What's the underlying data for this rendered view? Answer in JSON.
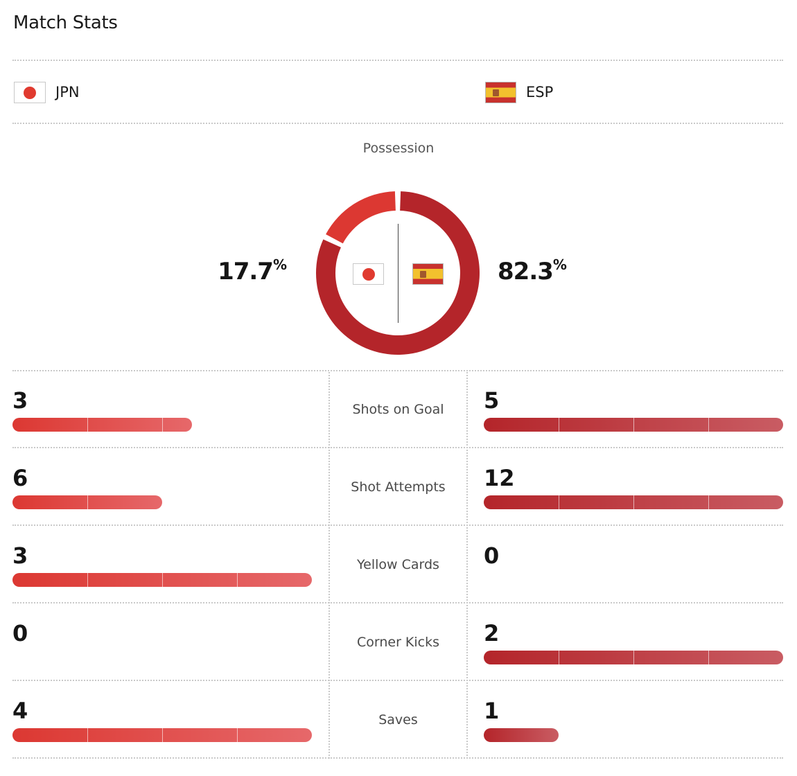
{
  "title": "Match Stats",
  "teams": {
    "home": {
      "abbr": "JPN",
      "flag": "japan-flag-icon"
    },
    "away": {
      "abbr": "ESP",
      "flag": "spain-flag-icon"
    }
  },
  "colors": {
    "home_primary": "#e03a2f",
    "away_primary": "#b4252a",
    "divider": "#c9c9c9",
    "label": "#555555"
  },
  "possession": {
    "label": "Possession",
    "home": "17.7",
    "away": "82.3",
    "unit": "%",
    "home_fraction": 0.177,
    "away_fraction": 0.823
  },
  "stats": [
    {
      "label": "Shots on Goal",
      "home": "3",
      "away": "5",
      "home_fraction": 0.6,
      "away_fraction": 1.0
    },
    {
      "label": "Shot Attempts",
      "home": "6",
      "away": "12",
      "home_fraction": 0.5,
      "away_fraction": 1.0
    },
    {
      "label": "Yellow Cards",
      "home": "3",
      "away": "0",
      "home_fraction": 1.0,
      "away_fraction": 0.0
    },
    {
      "label": "Corner Kicks",
      "home": "0",
      "away": "2",
      "home_fraction": 0.0,
      "away_fraction": 1.0
    },
    {
      "label": "Saves",
      "home": "4",
      "away": "1",
      "home_fraction": 1.0,
      "away_fraction": 0.25
    }
  ]
}
